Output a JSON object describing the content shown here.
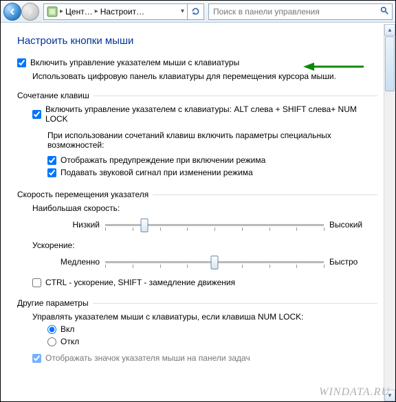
{
  "nav": {
    "breadcrumb_item1": "Цент…",
    "breadcrumb_item2": "Настроит…",
    "search_placeholder": "Поиск в панели управления"
  },
  "page": {
    "title": "Настроить кнопки мыши",
    "enable_mouse_keys_label": "Включить управление указателем мыши с клавиатуры",
    "enable_mouse_keys_desc": "Использовать цифровую панель клавиатуры для перемещения курсора мыши."
  },
  "section_shortcut": {
    "heading": "Сочетание клавиш",
    "enable_shortcut_label": "Включить управление указателем с клавиатуры: ALT слева + SHIFT слева+ NUM LOCK",
    "sub_desc": "При использовании сочетаний клавиш включить параметры специальных возможностей:",
    "warn_label": "Отображать предупреждение при включении режима",
    "beep_label": "Подавать звуковой сигнал при изменении режима"
  },
  "section_speed": {
    "heading": "Скорость перемещения указателя",
    "max_speed_label": "Наибольшая скорость:",
    "speed_low": "Низкий",
    "speed_high": "Высокий",
    "accel_label": "Ускорение:",
    "accel_low": "Медленно",
    "accel_high": "Быстро",
    "ctrl_shift_label": "CTRL - ускорение, SHIFT - замедление движения",
    "speed_value_pct": 18,
    "accel_value_pct": 50
  },
  "section_other": {
    "heading": "Другие параметры",
    "numlock_label": "Управлять указателем мыши с клавиатуры, если клавиша NUM LOCK:",
    "on_label": "Вкл",
    "off_label": "Откл",
    "show_icon_label": "Отображать значок указателя мыши на панели задач"
  },
  "watermark": "WINDATA.RU"
}
